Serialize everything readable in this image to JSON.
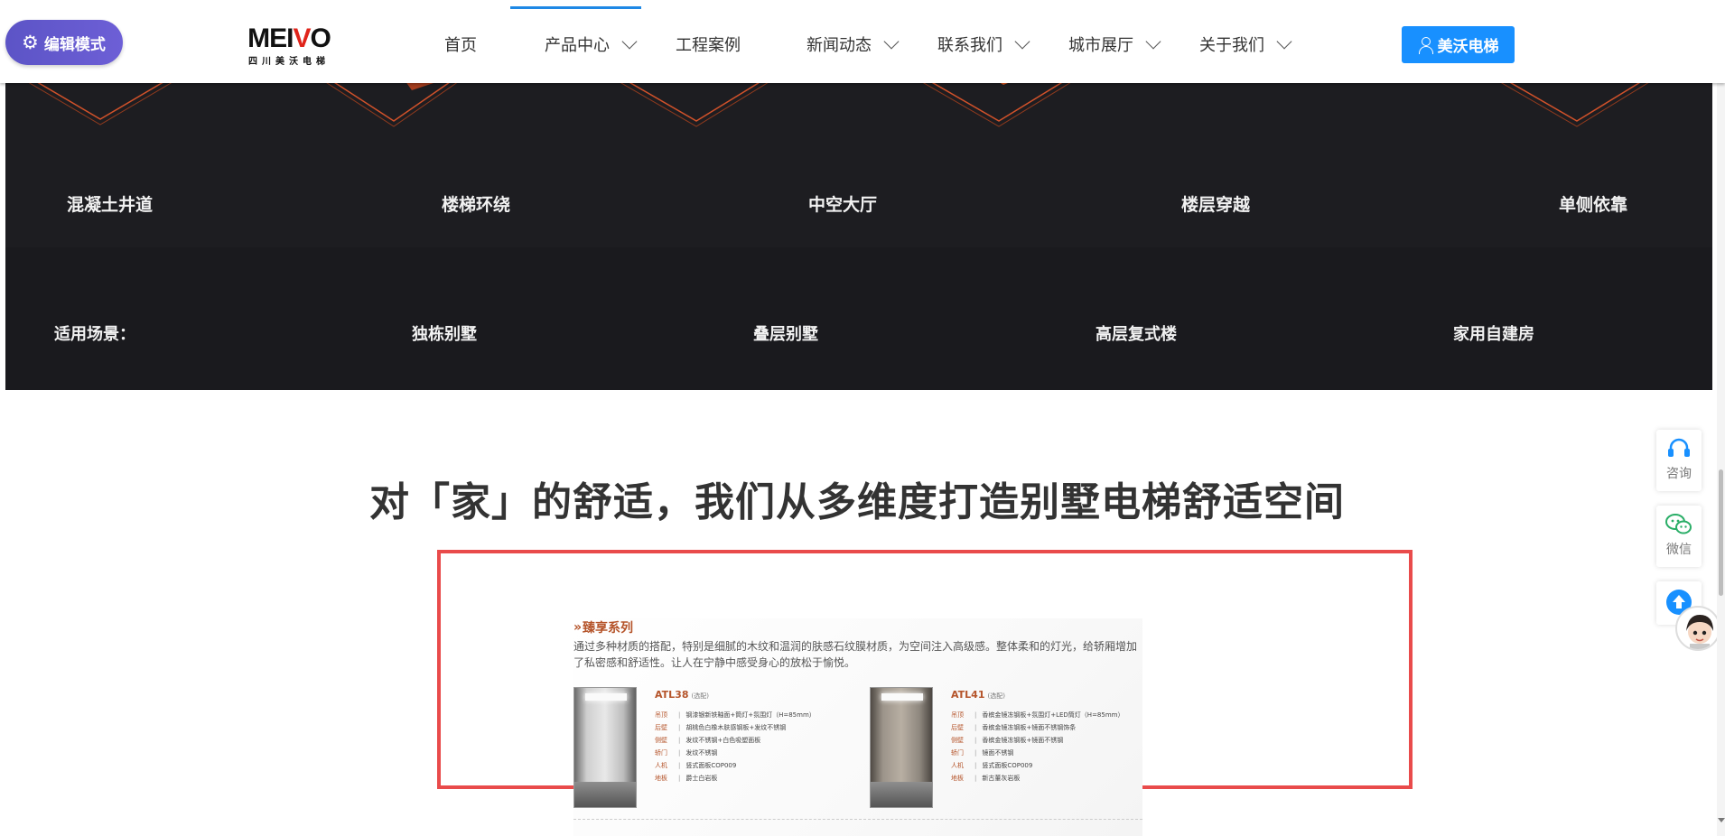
{
  "edit_mode": {
    "label": "编辑模式",
    "icon": "gear-icon"
  },
  "logo": {
    "brand": "MEIVO",
    "brand_pre": "MEI",
    "brand_v": "V",
    "brand_post": "O",
    "tagline": "四川美沃电梯"
  },
  "nav": {
    "items": [
      {
        "label": "首页",
        "has_dropdown": false
      },
      {
        "label": "产品中心",
        "has_dropdown": true,
        "active": true
      },
      {
        "label": "工程案例",
        "has_dropdown": false
      },
      {
        "label": "新闻动态",
        "has_dropdown": true
      },
      {
        "label": "联系我们",
        "has_dropdown": true
      },
      {
        "label": "城市展厅",
        "has_dropdown": true
      },
      {
        "label": "关于我们",
        "has_dropdown": true
      }
    ],
    "login_label": "美沃电梯",
    "accent": "#1890ff"
  },
  "install_types": [
    "混凝土井道",
    "楼梯环绕",
    "中空大厅",
    "楼层穿越",
    "单侧依靠"
  ],
  "scenes": {
    "label": "适用场景：",
    "items": [
      "独栋别墅",
      "叠层别墅",
      "高层复式楼",
      "家用自建房"
    ]
  },
  "section_heading": "对「家」的舒适，我们从多维度打造别墅电梯舒适空间",
  "feature_image": {
    "border_color": "#e94b4b",
    "series_title": "臻享系列",
    "description": "通过多种材质的搭配，特别是细腻的木纹和温润的肤感石纹膜材质，为空间注入高级感。整体柔和的灯光，给轿厢增加了私密感和舒适性。让人在宁静中感受身心的放松于愉悦。",
    "products": [
      {
        "model": "ATL38",
        "tag": "(选配)",
        "specs": [
          {
            "k": "吊顶",
            "v": "钢漆银新铁釉面+筒灯+氛围灯（H=85mm）"
          },
          {
            "k": "后壁",
            "v": "胡桃色白橡木肤感钢板+发纹不锈钢"
          },
          {
            "k": "侧壁",
            "v": "发纹不锈钢+白色吸塑面板"
          },
          {
            "k": "轿门",
            "v": "发纹不锈钢"
          },
          {
            "k": "人机",
            "v": "竖式面板COP009"
          },
          {
            "k": "地板",
            "v": "爵士白岩板"
          }
        ]
      },
      {
        "model": "ATL41",
        "tag": "(选配)",
        "specs": [
          {
            "k": "吊顶",
            "v": "香槟金镜冻钢板+氛围灯+LED筒灯（H=85mm）"
          },
          {
            "k": "后壁",
            "v": "香槟金镜冻钢板+镜面不锈钢饰条"
          },
          {
            "k": "侧壁",
            "v": "香槟金镜冻钢板+镜面不锈钢"
          },
          {
            "k": "轿门",
            "v": "镜面不锈钢"
          },
          {
            "k": "人机",
            "v": "竖式面板COP009"
          },
          {
            "k": "地板",
            "v": "新古董灰岩板"
          }
        ]
      }
    ]
  },
  "side_tools": [
    {
      "label": "咨询",
      "icon": "headset-icon"
    },
    {
      "label": "微信",
      "icon": "wechat-icon"
    },
    {
      "label": "",
      "icon": "arrow-up-icon"
    }
  ]
}
